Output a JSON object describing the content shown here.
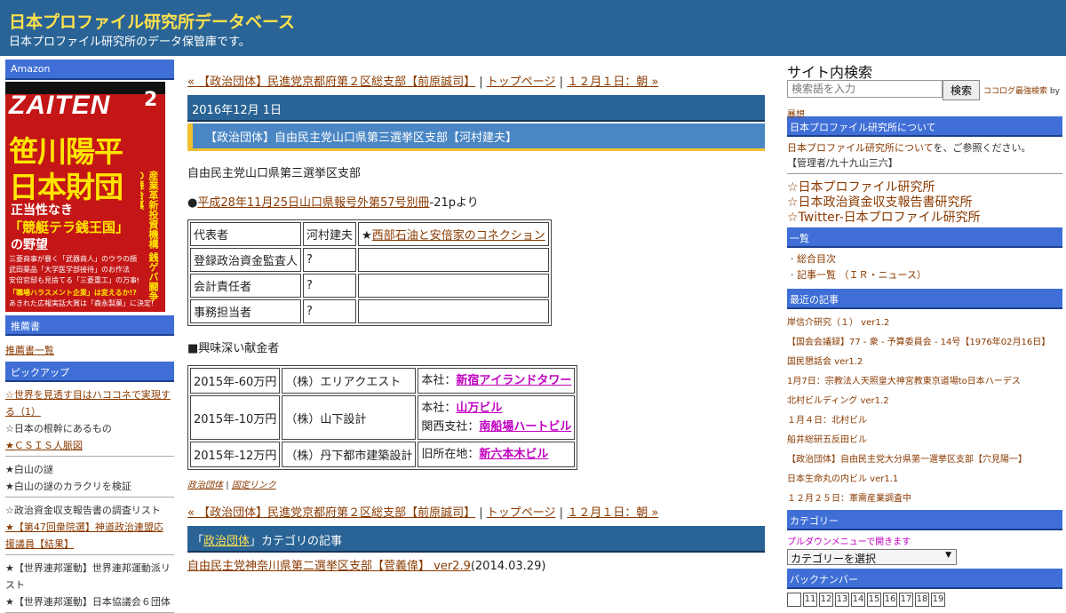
{
  "header": {
    "title": "日本プロファイル研究所データベース",
    "description": "日本プロファイル研究所のデータ保管庫です。"
  },
  "left": {
    "amazon_heading": "Amazon",
    "magazine": {
      "brand": "ZAITEN",
      "issue": "2",
      "headline_1": "笹川陽平",
      "headline_2": "日本財団",
      "sub_1": "正当性なき",
      "sub_2": "「競艇テラ銭王国」",
      "sub_3": "の野望",
      "side": "産業革新投資機構 銭ゲバ闘争の舞台裏",
      "line_1": "三菱商事が暴く「武器商人」のウラの顔",
      "line_2": "武田薬品「大学医学部接待」のお作法",
      "line_3": "安倍官邸も見捨てる「三菱重工」の万事休す",
      "line_4": "「職場ハラスメント企業」は変えるか!?",
      "line_5": "あきれた広報実話大賞は「森永製菓」に決定!"
    },
    "books_heading": "推薦書",
    "books_link": "推薦書一覧",
    "pickup_heading": "ピックアップ",
    "groups": [
      [
        {
          "text": "☆世界を見透す目はハココネで実現する（1）",
          "link": true
        },
        {
          "text": "☆日本の根幹にあるもの",
          "link": false
        },
        {
          "text": "★ＣＳＩＳ人脈図",
          "link": true
        }
      ],
      [
        {
          "text": "★白山の謎",
          "link": false
        },
        {
          "text": "★白山の謎のカラクリを検証",
          "link": false
        }
      ],
      [
        {
          "text": "☆政治資金収支報告書の調査リスト",
          "link": false
        },
        {
          "text": "★【第47回衆院選】神道政治連盟応援議員【結果】",
          "link": true
        }
      ],
      [
        {
          "text": "★【世界連邦運動】世界連邦運動派リスト",
          "link": false
        },
        {
          "text": "★【世界連邦運動】日本協議会６団体",
          "link": false
        }
      ]
    ]
  },
  "main": {
    "nav": {
      "prev": "« 【政治団体】民進党京都府第２区総支部【前原誠司】",
      "top": "トップページ",
      "next": "１２月１日：朝 »",
      "sep": "|"
    },
    "date": "2016年12月 1日",
    "title": "【政治団体】自由民主党山口県第三選挙区支部【河村建夫】",
    "org_name": "自由民主党山口県第三選挙区支部",
    "source_prefix": "●",
    "source_link": "平成28年11月25日山口県報号外第57号別冊",
    "source_suffix": "-21pより",
    "officers": [
      {
        "role": "代表者",
        "name": "河村建夫",
        "note_prefix": "★",
        "note_link": "西部石油と安倍家のコネクション"
      },
      {
        "role": "登録政治資金監査人",
        "name": "?",
        "note_prefix": "",
        "note_link": ""
      },
      {
        "role": "会計責任者",
        "name": "?",
        "note_prefix": "",
        "note_link": ""
      },
      {
        "role": "事務担当者",
        "name": "?",
        "note_prefix": "",
        "note_link": ""
      }
    ],
    "donation_heading": "■興味深い献金者",
    "donations": [
      {
        "amount": "2015年-60万円",
        "donor": "（株）エリアクエスト",
        "lines": [
          {
            "label": "本社：",
            "link": "新宿アイランドタワー"
          }
        ]
      },
      {
        "amount": "2015年-10万円",
        "donor": "（株）山下設計",
        "lines": [
          {
            "label": "本社：",
            "link": "山万ビル"
          },
          {
            "label": "関西支社：",
            "link": "南船場ハートビル"
          }
        ]
      },
      {
        "amount": "2015年-12万円",
        "donor": "（株）丹下都市建築設計",
        "lines": [
          {
            "label": "旧所在地：",
            "link": "新六本木ビル"
          }
        ]
      }
    ],
    "footer_category": "政治団体",
    "footer_permalink": "固定リンク",
    "category_prefix": "「",
    "category_name": "政治団体",
    "category_suffix": "」カテゴリの記事",
    "related": {
      "link": "自由民主党神奈川県第二選挙区支部【菅義偉】 ver2.9",
      "date": "(2014.03.29)"
    }
  },
  "right": {
    "search_title": "サイト内検索",
    "search_placeholder": "検索語を入力",
    "search_button": "検索",
    "search_credit_link": "ココログ最強検索",
    "search_credit_by": " by",
    "search_credit_author": "暴想",
    "about_heading": "日本プロファイル研究所について",
    "about_link": "日本プロファイル研究所について",
    "about_text": "を、ご参照ください。",
    "admin": "【管理者/九十九山三六】",
    "big_links": [
      "☆日本プロファイル研究所",
      "☆日本政治資金収支報告書研究所",
      "☆Twitter-日本プロファイル研究所"
    ],
    "list_heading": "一覧",
    "list_items": [
      "総合目次",
      "記事一覧 （ＩＲ・ニュース）"
    ],
    "recent_heading": "最近の記事",
    "recent": [
      "岸信介研究（１） ver1.2",
      "【国会会議録】77 - 衆 - 予算委員会 - 14号【1976年02月16日】",
      "国民懇話会 ver1.2",
      "1月7日：宗教法人天照皇大神宮教東京道場to日本ハーデス",
      "北村ビルディング ver1.2",
      "１月４日：北村ビル",
      "船井総研五反田ビル",
      "【政治団体】自由民主党大分県第一選挙区支部【穴見陽一】",
      "日本生命丸の内ビル ver1.1",
      "１２月２５日：軍需産業調査中"
    ],
    "category_heading": "カテゴリー",
    "category_note": "プルダウンメニューで開きます",
    "category_select": "カテゴリーを選択",
    "backnumber_heading": "バックナンバー",
    "backnumbers": [
      "",
      "11",
      "12",
      "13",
      "14",
      "15",
      "16",
      "17",
      "18",
      "19"
    ]
  }
}
